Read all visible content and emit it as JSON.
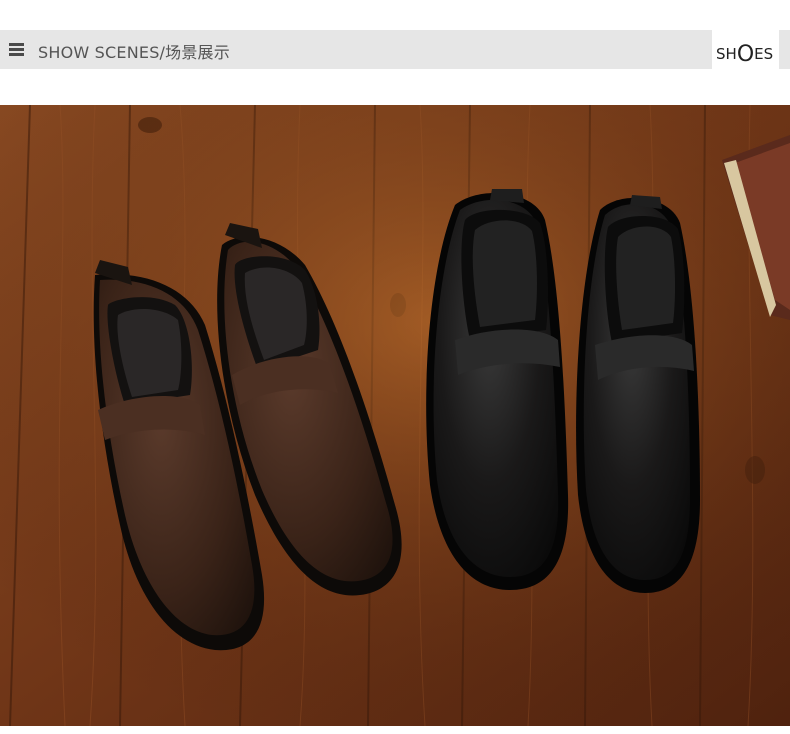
{
  "header": {
    "title": "SHOW SCENES/场景展示",
    "brand_pre": "SH",
    "brand_cap": "O",
    "brand_post": "ES"
  },
  "photo": {
    "description_icon": "product-photo",
    "subject": "shoes",
    "colors": {
      "wood": "#7a3f1c",
      "brown_shoe": "#3b2418",
      "black_shoe": "#151414",
      "sole": "#0b0a09"
    }
  }
}
